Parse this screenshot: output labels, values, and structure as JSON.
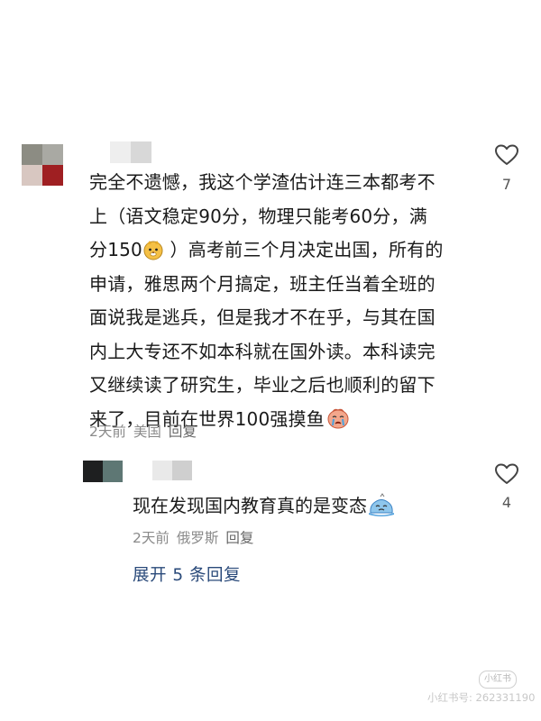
{
  "comment": {
    "lines": [
      "完全不遗憾，我这个学渣估计连三本都考不",
      "上（语文稳定90分，物理只能考60分，满",
      "分150",
      " ）高考前三个月决定出国，所有的",
      "申请，雅思两个月搞定，班主任当着全班的",
      "面说我是逃兵，但是我才不在乎，与其在国",
      "内上大专还不如本科就在国外读。本科读完",
      "又继续读了研究生，毕业之后也顺利的留下",
      "来了，目前在世界100强摸鱼"
    ],
    "time": "2天前",
    "location": "美国",
    "reply_label": "回复",
    "like_count": "7"
  },
  "reply": {
    "text": "现在发现国内教育真的是变态",
    "time": "2天前",
    "location": "俄罗斯",
    "reply_label": "回复",
    "like_count": "4"
  },
  "expand_label": "展开 5 条回复",
  "watermark": {
    "badge": "小红书",
    "text": "小红书号: 262331190"
  },
  "icons": {
    "like": "heart-outline-icon",
    "emoji_1": "doge-face-emoji",
    "emoji_2": "crying-face-emoji",
    "emoji_3": "melting-face-emoji"
  }
}
